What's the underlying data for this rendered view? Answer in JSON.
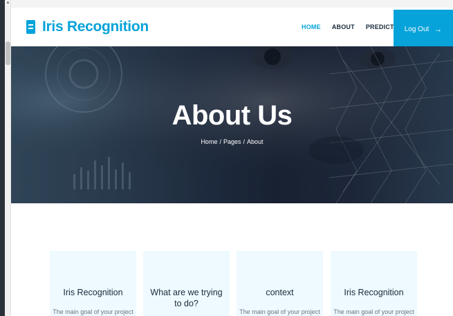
{
  "app": {
    "brand": "Iris Recognition"
  },
  "nav": {
    "items": [
      {
        "label": "HOME",
        "active": true
      },
      {
        "label": "ABOUT",
        "active": false
      },
      {
        "label": "PREDICTIONS",
        "active": false
      }
    ],
    "logout_label": "Log Out"
  },
  "hero": {
    "title": "About Us",
    "breadcrumb": [
      "Home",
      "Pages",
      "About"
    ]
  },
  "cards": [
    {
      "title": "Iris Recognition",
      "text": "The main goal of your project"
    },
    {
      "title": "What are we trying to do?",
      "text": ""
    },
    {
      "title": "context",
      "text": "The main goal of your project"
    },
    {
      "title": "Iris Recognition",
      "text": "The main goal of your project"
    }
  ],
  "colors": {
    "accent": "#06a3da",
    "card_bg": "#eefaff",
    "nav_text": "#1a2a3a"
  },
  "icons": {
    "brand": "book-icon",
    "logout": "arrow-right-icon"
  }
}
